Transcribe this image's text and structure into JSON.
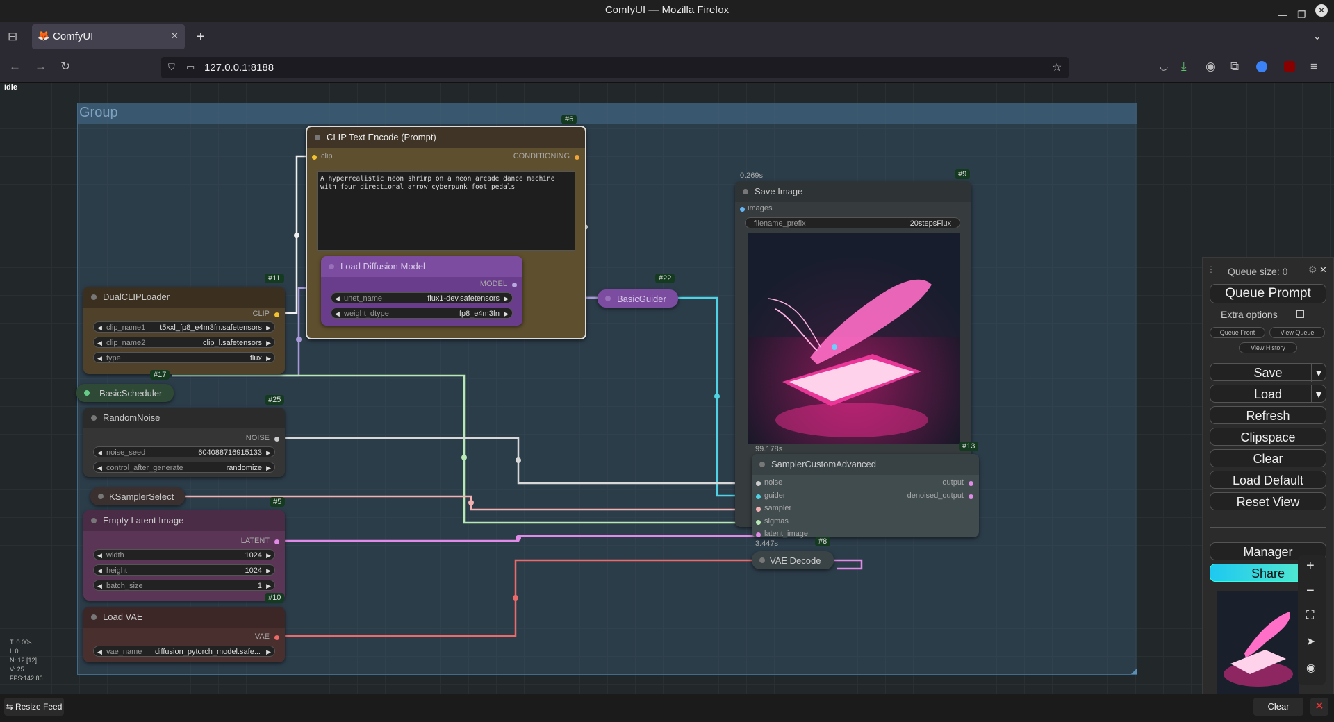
{
  "window": {
    "title": "ComfyUI — Mozilla Firefox"
  },
  "tab": {
    "label": "ComfyUI"
  },
  "url": "127.0.0.1:8188",
  "status": "Idle",
  "group": {
    "title": "Group"
  },
  "nodes": {
    "clip_text": {
      "badge": "#6",
      "title": "CLIP Text Encode (Prompt)",
      "input": "clip",
      "output": "CONDITIONING",
      "prompt": "A hyperrealistic neon shrimp on a neon arcade dance machine with four directional arrow cyberpunk foot pedals"
    },
    "dual_clip": {
      "badge": "#11",
      "title": "DualCLIPLoader",
      "output": "CLIP",
      "widgets": [
        {
          "label": "clip_name1",
          "value": "t5xxl_fp8_e4m3fn.safetensors"
        },
        {
          "label": "clip_name2",
          "value": "clip_l.safetensors"
        },
        {
          "label": "type",
          "value": "flux"
        }
      ]
    },
    "load_diffusion": {
      "title": "Load Diffusion Model",
      "output": "MODEL",
      "widgets": [
        {
          "label": "unet_name",
          "value": "flux1-dev.safetensors"
        },
        {
          "label": "weight_dtype",
          "value": "fp8_e4m3fn"
        }
      ]
    },
    "basic_guider": {
      "badge": "#22",
      "title": "BasicGuider"
    },
    "basic_scheduler": {
      "badge": "#17",
      "title": "BasicScheduler"
    },
    "random_noise": {
      "badge": "#25",
      "title": "RandomNoise",
      "output": "NOISE",
      "widgets": [
        {
          "label": "noise_seed",
          "value": "604088716915133"
        },
        {
          "label": "control_after_generate",
          "value": "randomize"
        }
      ]
    },
    "ksampler_select": {
      "title": "KSamplerSelect"
    },
    "empty_latent": {
      "badge": "#5",
      "title": "Empty Latent Image",
      "output": "LATENT",
      "widgets": [
        {
          "label": "width",
          "value": "1024"
        },
        {
          "label": "height",
          "value": "1024"
        },
        {
          "label": "batch_size",
          "value": "1"
        }
      ]
    },
    "load_vae": {
      "badge": "#10",
      "title": "Load VAE",
      "output": "VAE",
      "widgets": [
        {
          "label": "vae_name",
          "value": "diffusion_pytorch_model.safe..."
        }
      ]
    },
    "save_image": {
      "badge": "#9",
      "time": "0.269s",
      "title": "Save Image",
      "input": "images",
      "widgets": [
        {
          "label": "filename_prefix",
          "value": "20stepsFlux"
        }
      ]
    },
    "sampler_custom": {
      "badge": "#13",
      "time": "99.178s",
      "title": "SamplerCustomAdvanced",
      "inputs": [
        "noise",
        "guider",
        "sampler",
        "sigmas",
        "latent_image"
      ],
      "outputs": [
        "output",
        "denoised_output"
      ]
    },
    "vae_decode": {
      "badge": "#8",
      "time": "3.447s",
      "title": "VAE Decode"
    }
  },
  "stats": {
    "t": "T: 0.00s",
    "i": "I: 0",
    "n": "N: 12 [12]",
    "v": "V: 25",
    "fps": "FPS:142.86"
  },
  "queue": {
    "size": "Queue size: 0",
    "queue_prompt": "Queue Prompt",
    "extra_options": "Extra options",
    "queue_front": "Queue Front",
    "view_queue": "View Queue",
    "view_history": "View History",
    "save": "Save",
    "load": "Load",
    "refresh": "Refresh",
    "clipspace": "Clipspace",
    "clear": "Clear",
    "load_default": "Load Default",
    "reset_view": "Reset View",
    "manager": "Manager",
    "share": "Share"
  },
  "bottom": {
    "resize_feed": "Resize Feed",
    "clear": "Clear"
  },
  "colors": {
    "clip_node": "#5e4f2e",
    "dual_clip_node": "#4f412a",
    "purple_node": "#6a3d8c",
    "latent_node": "#5a3556",
    "vae_node": "#4a2f2f",
    "group_fill": "#3a5973",
    "share_button": "#22d3f0"
  }
}
